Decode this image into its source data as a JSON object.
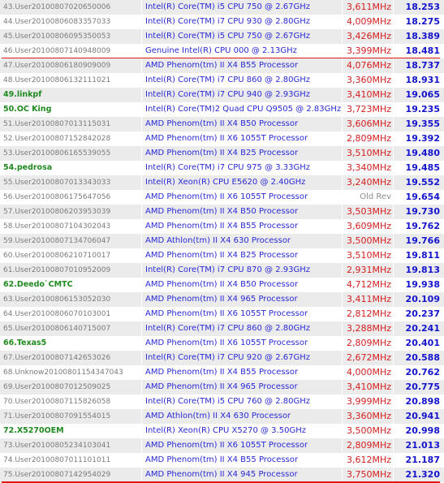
{
  "rows": [
    {
      "user": "43.User20100807020650006",
      "cpu": "Intel(R) Core(TM) i5 CPU 750 @ 2.67GHz",
      "mhz": "3,611MHz",
      "time": "18.253",
      "named": false
    },
    {
      "user": "44.User20100806083357033",
      "cpu": "Intel(R) Core(TM) i7 CPU 930 @ 2.80GHz",
      "mhz": "4,009MHz",
      "time": "18.275",
      "named": false
    },
    {
      "user": "45.User20100806095350053",
      "cpu": "Intel(R) Core(TM) i5 CPU 750 @ 2.67GHz",
      "mhz": "3,426MHz",
      "time": "18.389",
      "named": false
    },
    {
      "user": "46.User20100807140948009",
      "cpu": "Genuine Intel(R) CPU 000 @ 2.13GHz",
      "mhz": "3,399MHz",
      "time": "18.481",
      "named": false
    },
    {
      "user": "47.User20100806180909009",
      "cpu": "AMD Phenom(tm) II X4 B55 Processor",
      "mhz": "4,076MHz",
      "time": "18.737",
      "named": false
    },
    {
      "user": "48.User20100806132111021",
      "cpu": "Intel(R) Core(TM) i7 CPU 860 @ 2.80GHz",
      "mhz": "3,360MHz",
      "time": "18.931",
      "named": false
    },
    {
      "user": "49.linkpf",
      "cpu": "Intel(R) Core(TM) i7 CPU 940 @ 2.93GHz",
      "mhz": "3,410MHz",
      "time": "19.065",
      "named": true
    },
    {
      "user": "50.OC King",
      "cpu": "Intel(R) Core(TM)2 Quad CPU Q9505 @ 2.83GHz",
      "mhz": "3,723MHz",
      "time": "19.235",
      "named": true
    },
    {
      "user": "51.User20100807013115031",
      "cpu": "AMD Phenom(tm) II X4 B50 Processor",
      "mhz": "3,606MHz",
      "time": "19.355",
      "named": false
    },
    {
      "user": "52.User20100807152842028",
      "cpu": "AMD Phenom(tm) II X6 1055T Processor",
      "mhz": "2,809MHz",
      "time": "19.392",
      "named": false
    },
    {
      "user": "53.User20100806165539055",
      "cpu": "AMD Phenom(tm) II X4 B25 Processor",
      "mhz": "3,510MHz",
      "time": "19.480",
      "named": false
    },
    {
      "user": "54.pedrosa",
      "cpu": "Intel(R) Core(TM) i7 CPU 975 @ 3.33GHz",
      "mhz": "3,340MHz",
      "time": "19.485",
      "named": true
    },
    {
      "user": "55.User20100807013343033",
      "cpu": "Intel(R) Xeon(R) CPU E5620 @ 2.40GHz",
      "mhz": "3,240MHz",
      "time": "19.552",
      "named": false
    },
    {
      "user": "56.User20100806175647056",
      "cpu": "AMD Phenom(tm) II X6 1055T Processor",
      "mhz": "Old Rev",
      "time": "19.654",
      "named": false,
      "oldrev": true
    },
    {
      "user": "57.User20100806203953039",
      "cpu": "AMD Phenom(tm) II X4 B50 Processor",
      "mhz": "3,503MHz",
      "time": "19.730",
      "named": false
    },
    {
      "user": "58.User20100807104302043",
      "cpu": "AMD Phenom(tm) II X4 B55 Processor",
      "mhz": "3,609MHz",
      "time": "19.762",
      "named": false
    },
    {
      "user": "59.User20100807134706047",
      "cpu": "AMD Athlon(tm) II X4 630 Processor",
      "mhz": "3,500MHz",
      "time": "19.766",
      "named": false
    },
    {
      "user": "60.User20100806210710017",
      "cpu": "AMD Phenom(tm) II X4 B25 Processor",
      "mhz": "3,510MHz",
      "time": "19.811",
      "named": false
    },
    {
      "user": "61.User20100807010952009",
      "cpu": "Intel(R) Core(TM) i7 CPU 870 @ 2.93GHz",
      "mhz": "2,931MHz",
      "time": "19.813",
      "named": false
    },
    {
      "user": "62.Deedo`CMTC",
      "cpu": "AMD Phenom(tm) II X4 B50 Processor",
      "mhz": "4,712MHz",
      "time": "19.938",
      "named": true
    },
    {
      "user": "63.User20100806153052030",
      "cpu": "AMD Phenom(tm) II X4 965 Processor",
      "mhz": "3,411MHz",
      "time": "20.109",
      "named": false
    },
    {
      "user": "64.User20100806070103001",
      "cpu": "AMD Phenom(tm) II X6 1055T Processor",
      "mhz": "2,812MHz",
      "time": "20.237",
      "named": false
    },
    {
      "user": "65.User20100806140715007",
      "cpu": "Intel(R) Core(TM) i7 CPU 860 @ 2.80GHz",
      "mhz": "3,288MHz",
      "time": "20.241",
      "named": false
    },
    {
      "user": "66.Texas5",
      "cpu": "AMD Phenom(tm) II X6 1055T Processor",
      "mhz": "2,809MHz",
      "time": "20.401",
      "named": true
    },
    {
      "user": "67.User20100807142653026",
      "cpu": "Intel(R) Core(TM) i7 CPU 920 @ 2.67GHz",
      "mhz": "2,672MHz",
      "time": "20.588",
      "named": false
    },
    {
      "user": "68.Unknow20100801154347043",
      "cpu": "AMD Phenom(tm) II X4 B55 Processor",
      "mhz": "4,000MHz",
      "time": "20.762",
      "named": false
    },
    {
      "user": "69.User20100807012509025",
      "cpu": "AMD Phenom(tm) II X4 965 Processor",
      "mhz": "3,410MHz",
      "time": "20.775",
      "named": false
    },
    {
      "user": "70.User20100807115826058",
      "cpu": "Intel(R) Core(TM) i5 CPU 760 @ 2.80GHz",
      "mhz": "3,999MHz",
      "time": "20.898",
      "named": false
    },
    {
      "user": "71.User20100807091554015",
      "cpu": "AMD Athlon(tm) II X4 630 Processor",
      "mhz": "3,360MHz",
      "time": "20.941",
      "named": false
    },
    {
      "user": "72.X5270OEM",
      "cpu": "Intel(R) Xeon(R) CPU X5270 @ 3.50GHz",
      "mhz": "3,500MHz",
      "time": "20.998",
      "named": true
    },
    {
      "user": "73.User20100805234103041",
      "cpu": "AMD Phenom(tm) II X6 1055T Processor",
      "mhz": "2,809MHz",
      "time": "21.013",
      "named": false
    },
    {
      "user": "74.User20100807011101011",
      "cpu": "AMD Phenom(tm) II X4 B55 Processor",
      "mhz": "3,612MHz",
      "time": "21.187",
      "named": false
    },
    {
      "user": "75.User20100807142954029",
      "cpu": "AMD Phenom(tm) II X4 945 Processor",
      "mhz": "3,750MHz",
      "time": "21.320",
      "named": false
    }
  ],
  "highlight_rows": [
    "46.User20100807140948009",
    "75.User20100807142954029"
  ],
  "colors": {
    "row_alt": "#ebebeb",
    "user_gray": "#7b7b7b",
    "user_named_green": "#1f8a1f",
    "cpu_blue": "#2a2ad6",
    "mhz_red": "#d42020",
    "time_blue": "#1414cc",
    "underline_red": "#e01818"
  }
}
